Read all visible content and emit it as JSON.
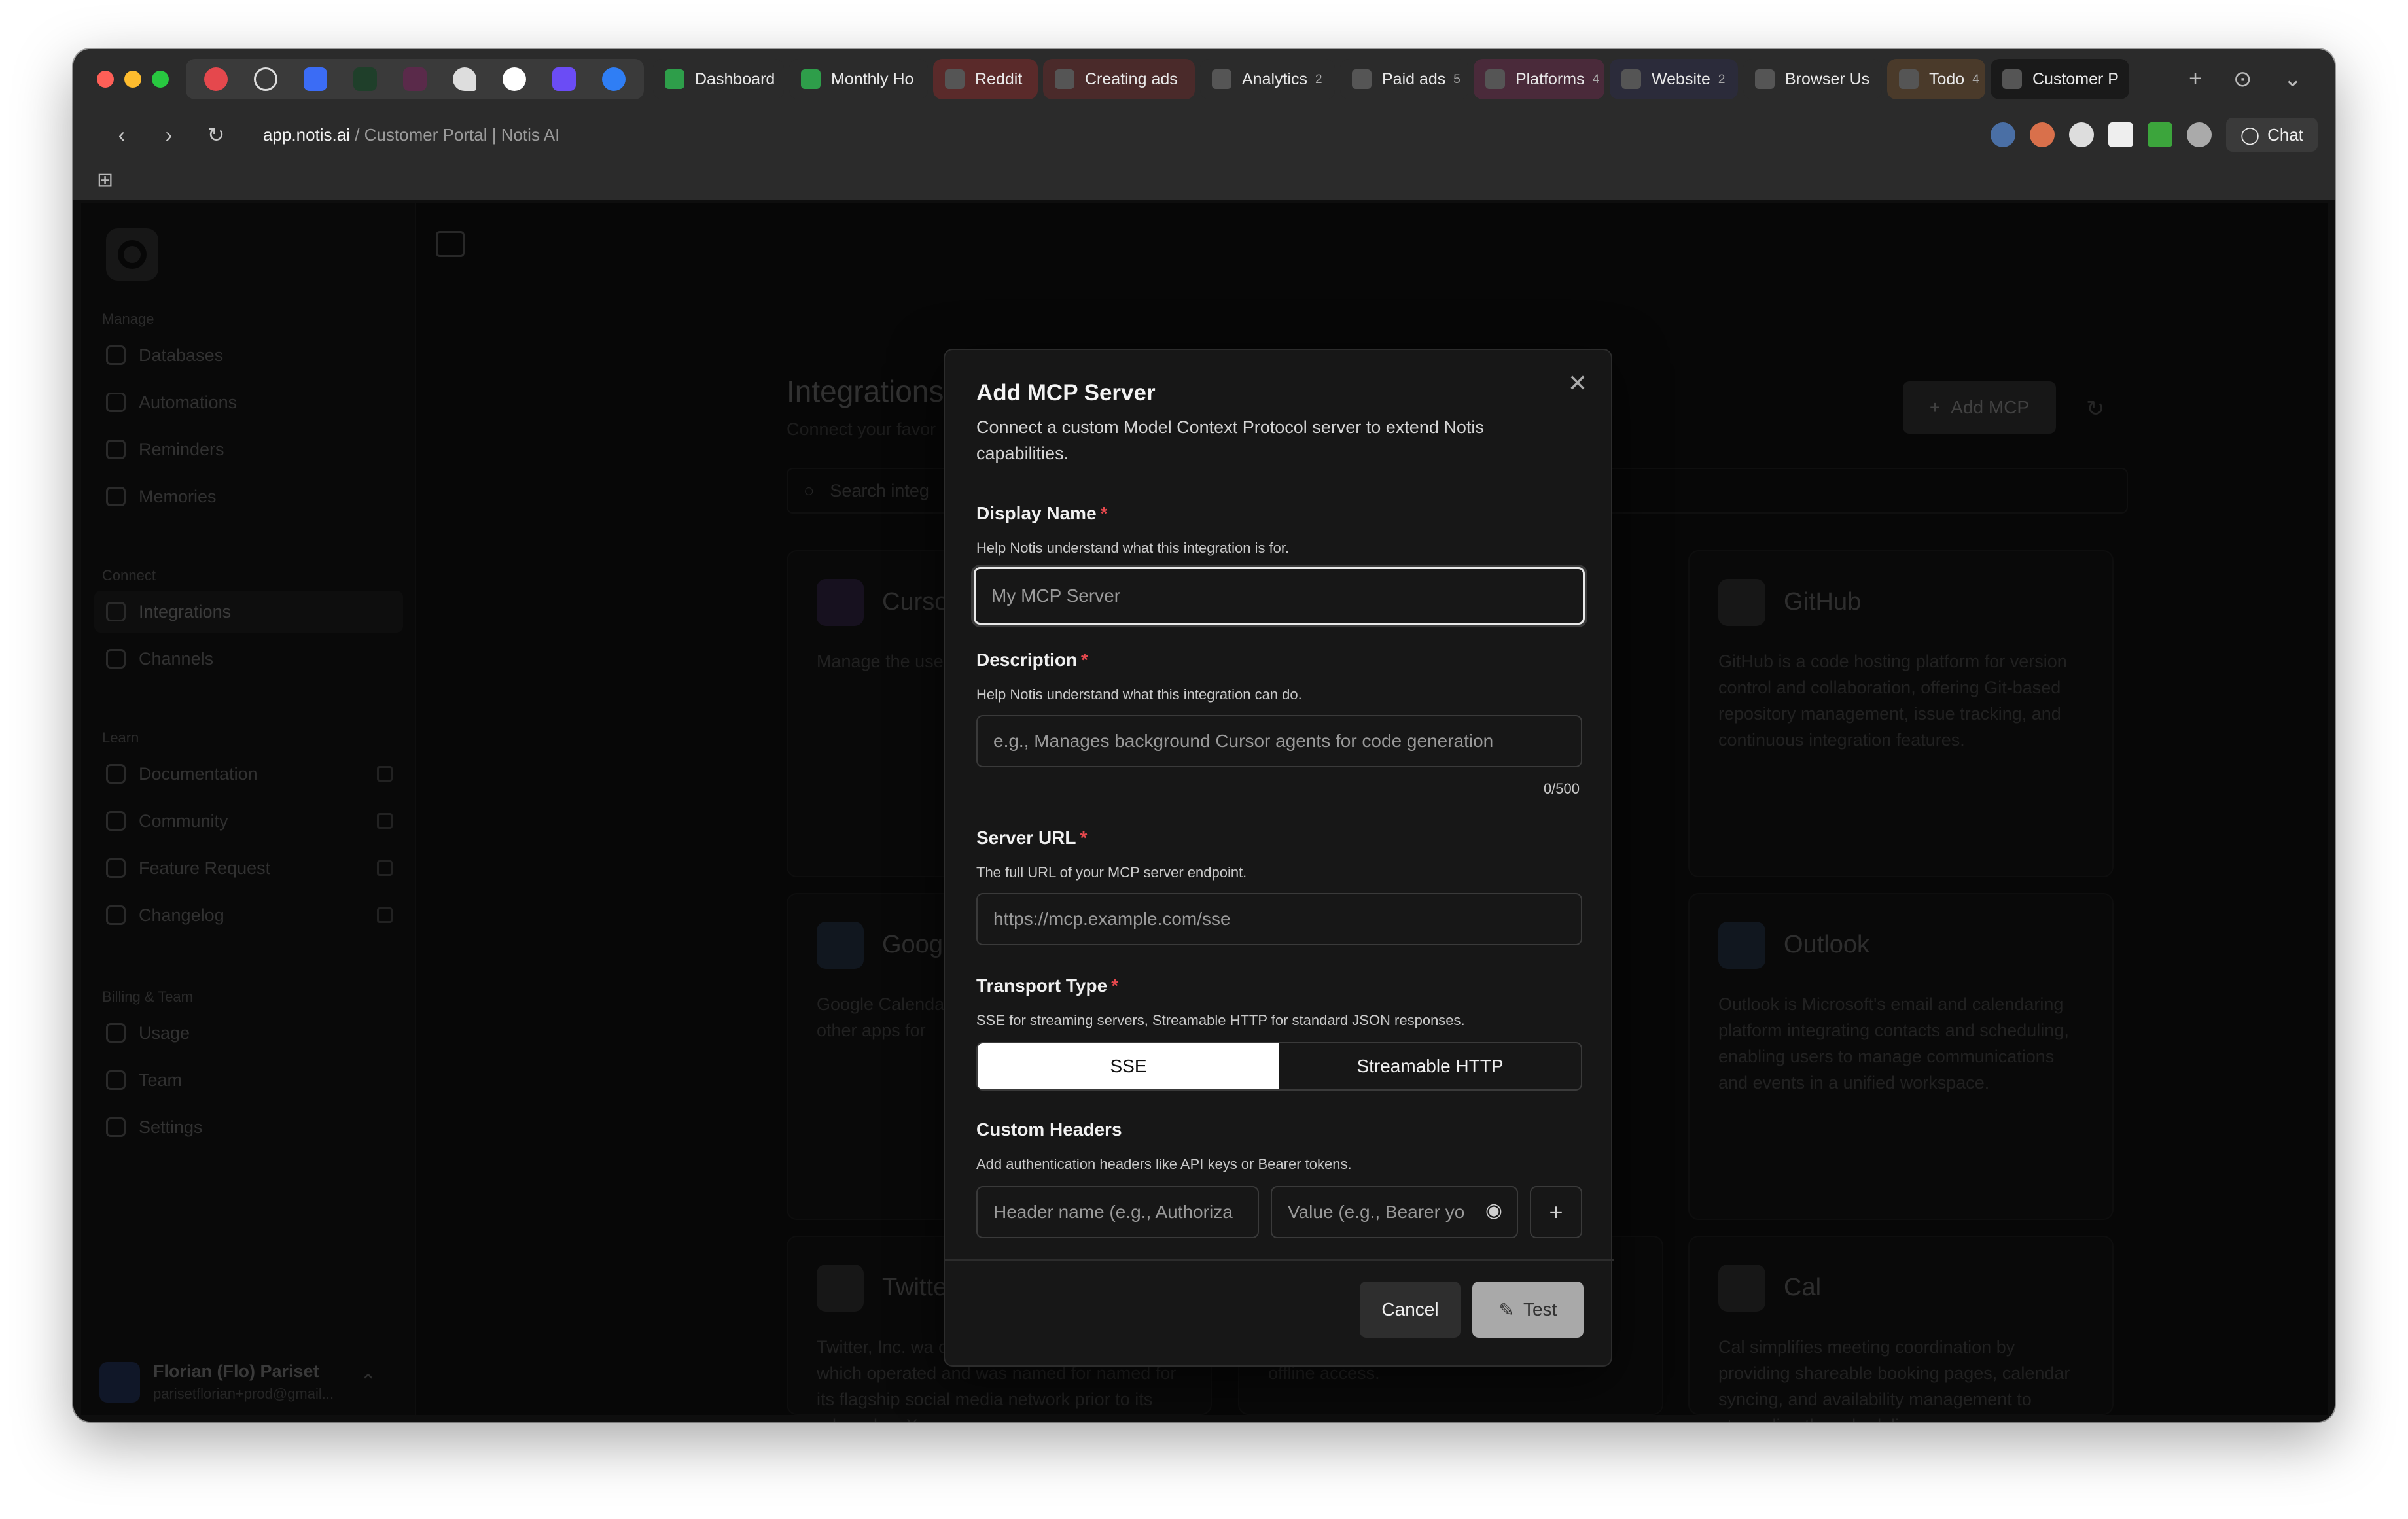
{
  "browser": {
    "pinned_icons": [
      "youtube-icon",
      "openai-icon",
      "intercom-icon",
      "slack-icon",
      "email-icon",
      "figma-icon",
      "vercel-icon",
      "linear-icon",
      "canva-icon"
    ],
    "tabs": [
      {
        "label": "Dashboard",
        "color": "#4caf50",
        "badge": ""
      },
      {
        "label": "Monthly Ho",
        "color": "#4caf50",
        "badge": ""
      },
      {
        "label": "Reddit",
        "color": "#5a2a2a",
        "badge": ""
      },
      {
        "label": "Creating ads",
        "color": "#4a2a2a",
        "badge": ""
      },
      {
        "label": "Analytics",
        "color": "#2b2b2b",
        "badge": "2"
      },
      {
        "label": "Paid ads",
        "color": "#2b2b2b",
        "badge": "5"
      },
      {
        "label": "Platforms",
        "color": "#4a2a3a",
        "badge": "4"
      },
      {
        "label": "Website",
        "color": "#2b2b3a",
        "badge": "2"
      },
      {
        "label": "Browser Us",
        "color": "#2b2b2b",
        "badge": ""
      },
      {
        "label": "Todo",
        "color": "#4a3a2a",
        "badge": "4"
      },
      {
        "label": "Customer P",
        "color": "#1a1a1a",
        "badge": ""
      }
    ],
    "url_host": "app.notis.ai",
    "url_rest": " / Customer Portal | Notis AI",
    "chat_label": "Chat"
  },
  "sidebar": {
    "groups": [
      {
        "label": "Manage",
        "items": [
          "Databases",
          "Automations",
          "Reminders",
          "Memories"
        ]
      },
      {
        "label": "Connect",
        "items": [
          "Integrations",
          "Channels"
        ]
      },
      {
        "label": "Learn",
        "items": [
          "Documentation",
          "Community",
          "Feature Request",
          "Changelog"
        ]
      },
      {
        "label": "Billing & Team",
        "items": [
          "Usage",
          "Team",
          "Settings"
        ]
      }
    ],
    "user_name": "Florian (Flo) Pariset",
    "user_email": "parisetflorian+prod@gmail..."
  },
  "page": {
    "title": "Integrations",
    "subtitle": "Connect your favor",
    "search_placeholder": "Search integ",
    "add_mcp": "Add MCP",
    "cards": [
      {
        "title": "Cursor",
        "desc": "Manage the use agents"
      },
      {
        "title": "GitHub",
        "desc": "GitHub is a code hosting platform for version control and collaboration, offering Git-based repository management, issue tracking, and continuous integration features."
      },
      {
        "title": "Google",
        "desc": "Google Calenda tool providing reminders, and other apps for"
      },
      {
        "title": "Outlook",
        "desc": "Outlook is Microsoft's email and calendaring platform integrating contacts and scheduling, enabling users to manage communications and events in a unified workspace."
      },
      {
        "title": "Twitter",
        "desc": "Twitter, Inc. wa company based California, which operated and was named for named for its flagship social media network prior to its rebrand as X."
      },
      {
        "title": "Cal",
        "desc": "Cal simplifies meeting coordination by providing shareable booking pages, calendar syncing, and availability management to streamline the scheduling process."
      },
      {
        "title": "",
        "desc": "files across devices, with robust search and offline access."
      }
    ]
  },
  "modal": {
    "title": "Add MCP Server",
    "description": "Connect a custom Model Context Protocol server to extend Notis capabilities.",
    "display_name_label": "Display Name",
    "display_name_help": "Help Notis understand what this integration is for.",
    "display_name_placeholder": "My MCP Server",
    "description_label": "Description",
    "description_help": "Help Notis understand what this integration can do.",
    "description_placeholder": "e.g., Manages background Cursor agents for code generation",
    "description_counter": "0/500",
    "server_url_label": "Server URL",
    "server_url_help": "The full URL of your MCP server endpoint.",
    "server_url_placeholder": "https://mcp.example.com/sse",
    "transport_label": "Transport Type",
    "transport_help": "SSE for streaming servers, Streamable HTTP for standard JSON responses.",
    "transport_options": [
      "SSE",
      "Streamable HTTP"
    ],
    "transport_selected": "SSE",
    "headers_label": "Custom Headers",
    "headers_help": "Add authentication headers like API keys or Bearer tokens.",
    "header_name_placeholder": "Header name (e.g., Authoriza",
    "header_value_placeholder": "Value (e.g., Bearer yo",
    "required_mark": "*",
    "cancel_label": "Cancel",
    "test_label": "Test"
  }
}
